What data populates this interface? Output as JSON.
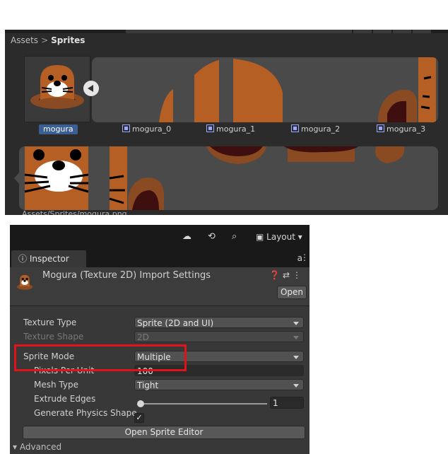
{
  "project": {
    "breadcrumb": [
      "Assets",
      "Sprites"
    ],
    "breadcrumb_sep": ">",
    "main_asset": "mogura",
    "sub_assets": [
      "mogura_0",
      "mogura_1",
      "mogura_2",
      "mogura_3"
    ],
    "footer_path": "Assets/Sprites/mogura.png"
  },
  "toolbar": {
    "cloud_icon": "cloud-icon",
    "history_icon": "history-icon",
    "search_icon": "search-icon",
    "layout_label": "Layout"
  },
  "inspector": {
    "tab_label": "Inspector",
    "title": "Mogura (Texture 2D) Import Settings",
    "open_button": "Open",
    "properties": {
      "texture_type": {
        "label": "Texture Type",
        "value": "Sprite (2D and UI)"
      },
      "texture_shape": {
        "label": "Texture Shape",
        "value": "2D"
      },
      "sprite_mode": {
        "label": "Sprite Mode",
        "value": "Multiple"
      },
      "pixels_per_unit": {
        "label": "Pixels Per Unit",
        "value": "100"
      },
      "mesh_type": {
        "label": "Mesh Type",
        "value": "Tight"
      },
      "extrude_edges": {
        "label": "Extrude Edges",
        "value": "1"
      },
      "generate_physics_shape": {
        "label": "Generate Physics Shape",
        "checked": true,
        "check_glyph": "✓"
      }
    },
    "open_sprite_editor": "Open Sprite Editor",
    "advanced_label": "Advanced"
  },
  "colors": {
    "mole_brown": "#b65f24",
    "dirt_dark": "#3f0e0e",
    "dirt_brown": "#8a4a22",
    "highlight_red": "#e0131a",
    "selection_blue": "#3b5f93"
  }
}
